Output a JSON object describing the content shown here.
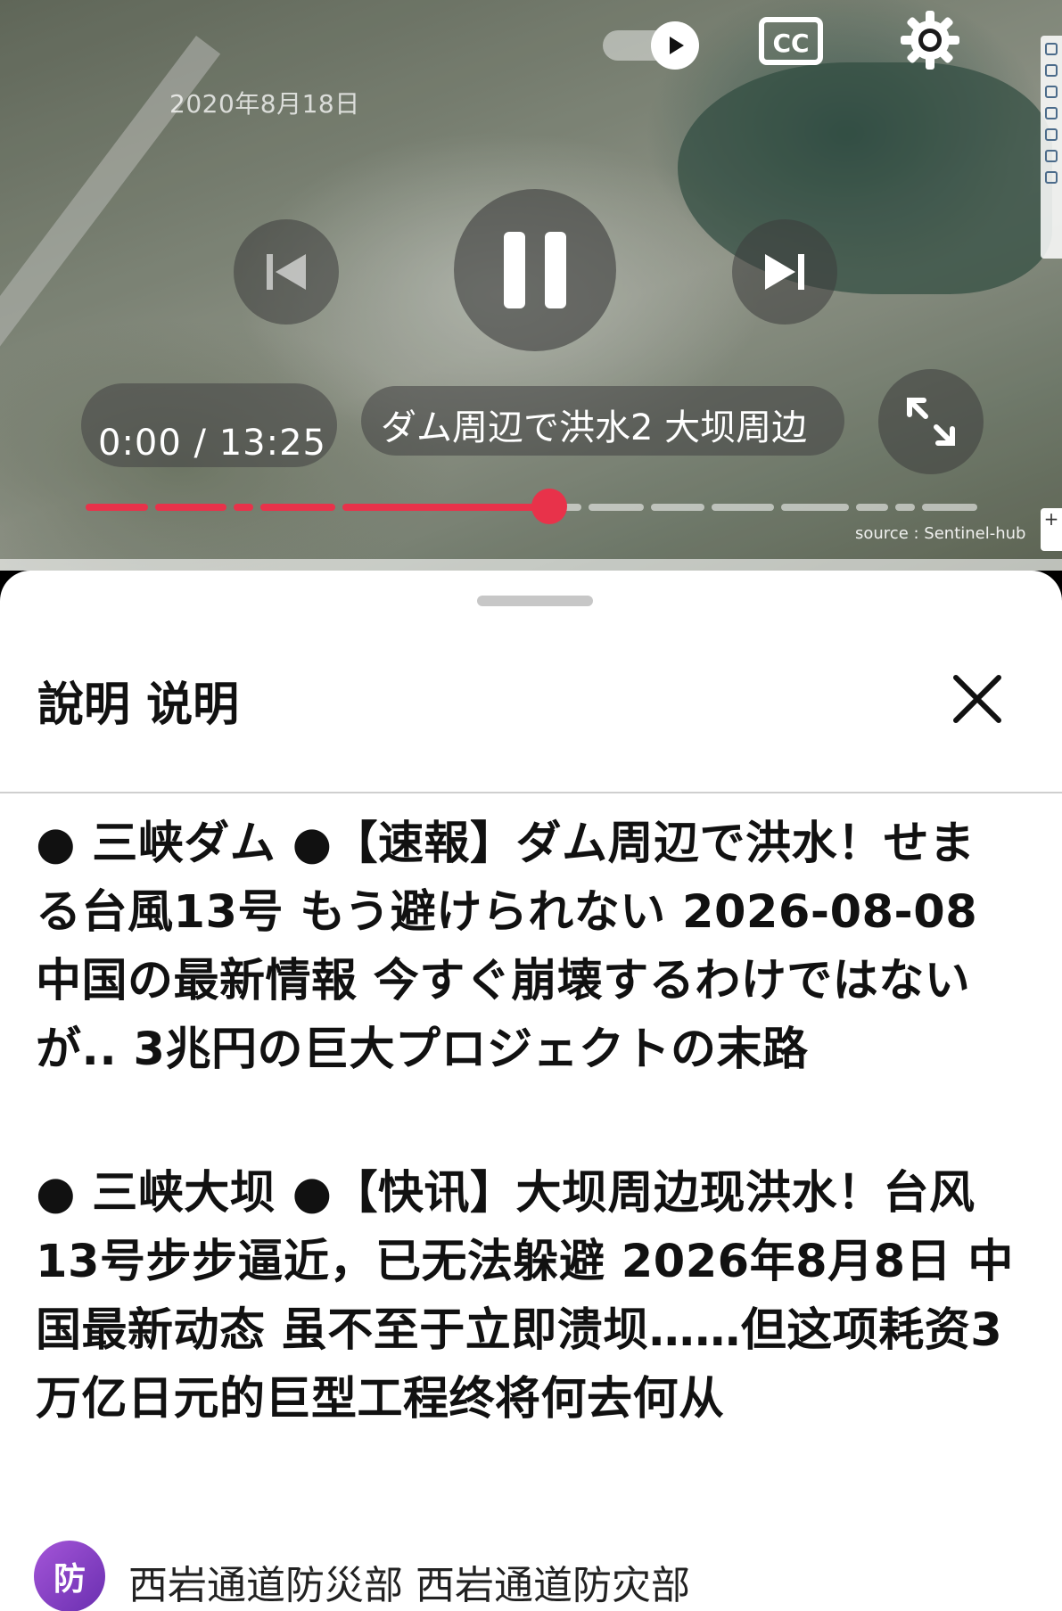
{
  "player": {
    "date_stamp": "2020年8月18日",
    "autoplay_state": "on",
    "cc_label": "CC",
    "time_display": "0:00 / 13:25",
    "video_title": "ダム周辺で洪水2 大坝周边",
    "source_label": "source : Sentinel-hub",
    "map_zoom_label": "+",
    "progress_fraction": 0.45,
    "accent_color": "#e8324a"
  },
  "description_sheet": {
    "title": "說明 说明",
    "text_ja": "● 三峡ダム ●【速報】ダム周辺で洪水！せまる台風13号 もう避けられない 2026-08-08 中国の最新情報 今すぐ崩壊するわけではないが.. 3兆円の巨大プロジェクトの末路",
    "text_zh": "● 三峡大坝 ●【快讯】大坝周边现洪水！台风13号步步逼近，已无法躲避 2026年8月8日 中国最新动态 虽不至于立即溃坝……但这项耗资3万亿日元的巨型工程终将何去何从",
    "channel_avatar_letter": "防",
    "channel_name": "西岩通道防災部 西岩通道防灾部"
  },
  "icons": {
    "play": "play-icon",
    "cc": "closed-captions-icon",
    "settings": "gear-icon",
    "previous": "skip-previous-icon",
    "pause": "pause-icon",
    "next": "skip-next-icon",
    "fullscreen": "fullscreen-icon",
    "close": "close-icon"
  }
}
